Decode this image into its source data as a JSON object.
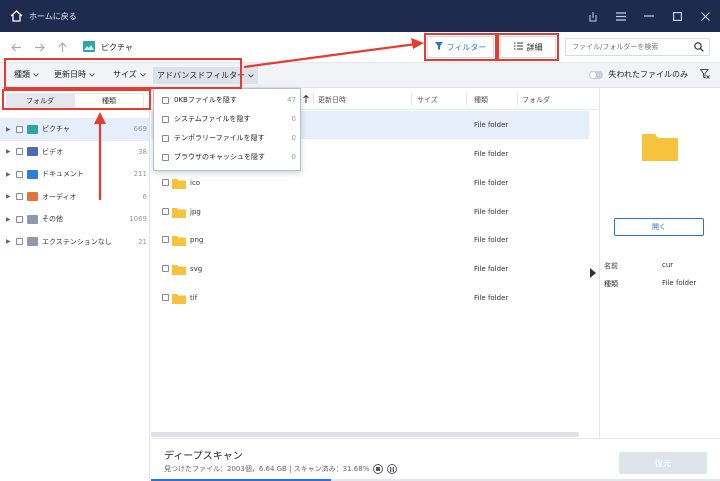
{
  "titlebar": {
    "title": "ホームに戻る"
  },
  "navbar": {
    "path": "ピクチャ"
  },
  "toolbar": {
    "filter_label": "フィルター",
    "detail_label": "詳細",
    "search_placeholder": "ファイル/フォルダーを検索"
  },
  "filterbar": {
    "type_label": "種類",
    "date_label": "更新日時",
    "size_label": "サイズ",
    "advanced_label": "アドバンスドフィルター",
    "lost_files_label": "失われたファイルのみ"
  },
  "dropdown": {
    "items": [
      {
        "label": "0KBファイルを隠す",
        "count": "47"
      },
      {
        "label": "システムファイルを隠す",
        "count": "0"
      },
      {
        "label": "テンポラリーファイルを隠す",
        "count": "0"
      },
      {
        "label": "ブラウザのキャッシュを隠す",
        "count": "0"
      }
    ]
  },
  "sidebar": {
    "tabs": [
      {
        "label": "フォルダ"
      },
      {
        "label": "種類"
      }
    ],
    "items": [
      {
        "label": "ピクチャ",
        "count": "669",
        "color": "#2fa3a6"
      },
      {
        "label": "ビデオ",
        "count": "38",
        "color": "#4b6bb5"
      },
      {
        "label": "ドキュメント",
        "count": "211",
        "color": "#2b7de0"
      },
      {
        "label": "オーディオ",
        "count": "6",
        "color": "#e0743a"
      },
      {
        "label": "その他",
        "count": "1069",
        "color": "#8e99ad"
      },
      {
        "label": "エクステンションなし",
        "count": "21",
        "color": "#8e99ad"
      }
    ]
  },
  "table": {
    "headers": {
      "date": "更新日時",
      "size": "サイズ",
      "type": "種類",
      "folder": "フォルダ"
    },
    "rows": [
      {
        "name": "",
        "type": "File folder"
      },
      {
        "name": "",
        "type": "File folder"
      },
      {
        "name": "ico",
        "type": "File folder"
      },
      {
        "name": "jpg",
        "type": "File folder"
      },
      {
        "name": "png",
        "type": "File folder"
      },
      {
        "name": "svg",
        "type": "File folder"
      },
      {
        "name": "tif",
        "type": "File folder"
      }
    ]
  },
  "right_panel": {
    "open_label": "開く",
    "name_label": "名前",
    "name_value": "cur",
    "type_label": "種類",
    "type_value": "File folder"
  },
  "bottom": {
    "title": "ディープスキャン",
    "status": "見つけたファイル：2003個，6.64 GB | スキャン済み：31.68%",
    "recover_label": "復元",
    "progress_fraction": 0.3168
  },
  "colors": {
    "accent": "#2b6fe0",
    "titlebar": "#1f2a4f",
    "highlight": "#e63b2e",
    "folder": "#f7c23c"
  }
}
